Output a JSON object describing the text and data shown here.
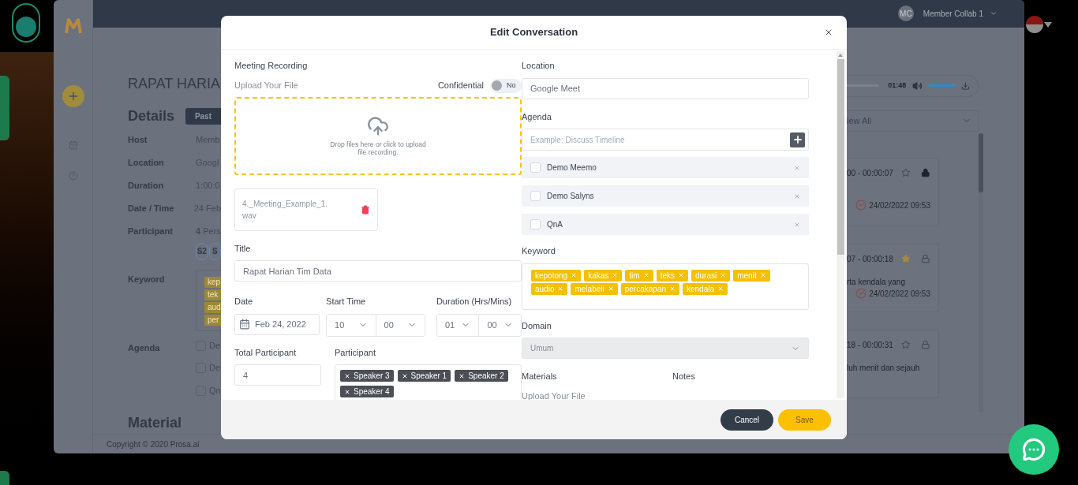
{
  "background": {
    "user_initials": "MC",
    "user_name": "Member Collab 1",
    "page_title": "RAPAT HARIA",
    "details_heading": "Details",
    "status_tab": "Past",
    "details": [
      {
        "label": "Host",
        "value": "Memb"
      },
      {
        "label": "Location",
        "value": "Googl"
      },
      {
        "label": "Duration",
        "value": "1:00:0"
      },
      {
        "label": "Date / Time",
        "value": "24 Feb"
      }
    ],
    "participant": {
      "label": "Participant",
      "count": "4",
      "unit": "Pers",
      "speakers": [
        "S2",
        "S"
      ]
    },
    "keyword": {
      "label": "Keyword",
      "tags": [
        "kep",
        "tek",
        "aud",
        "per"
      ]
    },
    "agenda": {
      "label": "Agenda",
      "items": [
        {
          "text": "De",
          "checked": false
        },
        {
          "text": "De",
          "checked": false
        },
        {
          "text": "Qn",
          "checked": false
        }
      ]
    },
    "material_heading": "Material",
    "copyright": "Copyright © 2020 Prosa.ai",
    "player": {
      "time": "01:48",
      "volume": {
        "level": 1
      }
    },
    "filter": "iew All",
    "segments": [
      {
        "time": "00 - 00:00:07",
        "starred": false,
        "locked": true,
        "date": "24/02/2022 09:53"
      },
      {
        "time": "07 - 00:00:18",
        "starred": true,
        "locked": false,
        "text": "rta kendala yang",
        "date": "24/02/2022 09:53"
      },
      {
        "time": "18 - 00:00:31",
        "starred": false,
        "locked": false,
        "text": "luh menit dan sejauh"
      }
    ]
  },
  "modal": {
    "title": "Edit Conversation",
    "recording": {
      "heading": "Meeting Recording",
      "upload_label": "Upload Your File",
      "confidential": {
        "label": "Confidential",
        "on": false,
        "state_text": "No"
      },
      "dropzone_text": "Drop files here or click to upload file recording.",
      "file_name": "4._Meeting_Example_1.wav"
    },
    "title_field": {
      "label": "Title",
      "value": "Rapat Harian Tim Data"
    },
    "date": {
      "label": "Date",
      "value": "Feb 24, 2022"
    },
    "start_time": {
      "label": "Start Time",
      "hour": "10",
      "minute": "00"
    },
    "duration": {
      "label": "Duration (Hrs/Mins)",
      "hours": "01",
      "minutes": "00"
    },
    "total_participant": {
      "label": "Total Participant",
      "value": "4"
    },
    "participants": {
      "label": "Participant",
      "tags": [
        "Speaker 3",
        "Speaker 1",
        "Speaker 2",
        "Speaker 4"
      ]
    },
    "location": {
      "label": "Location",
      "value": "Google Meet"
    },
    "agenda": {
      "label": "Agenda",
      "placeholder": "Example: Discuss Timeline",
      "items": [
        {
          "text": "Demo Meemo",
          "checked": false
        },
        {
          "text": "Demo Salyns",
          "checked": false
        },
        {
          "text": "QnA",
          "checked": false
        }
      ]
    },
    "keywords": {
      "label": "Keyword",
      "tags": [
        "kepotong",
        "kakas",
        "tim",
        "teks",
        "durasi",
        "menit",
        "audio",
        "melabeli",
        "percakapan",
        "kendala"
      ]
    },
    "domain": {
      "label": "Domain",
      "value": "Umum",
      "disabled": true
    },
    "materials": {
      "label": "Materials",
      "upload_label": "Upload Your File"
    },
    "notes": {
      "label": "Notes"
    },
    "buttons": [
      {
        "label": "Cancel",
        "kind": "secondary"
      },
      {
        "label": "Save",
        "kind": "primary"
      }
    ]
  }
}
